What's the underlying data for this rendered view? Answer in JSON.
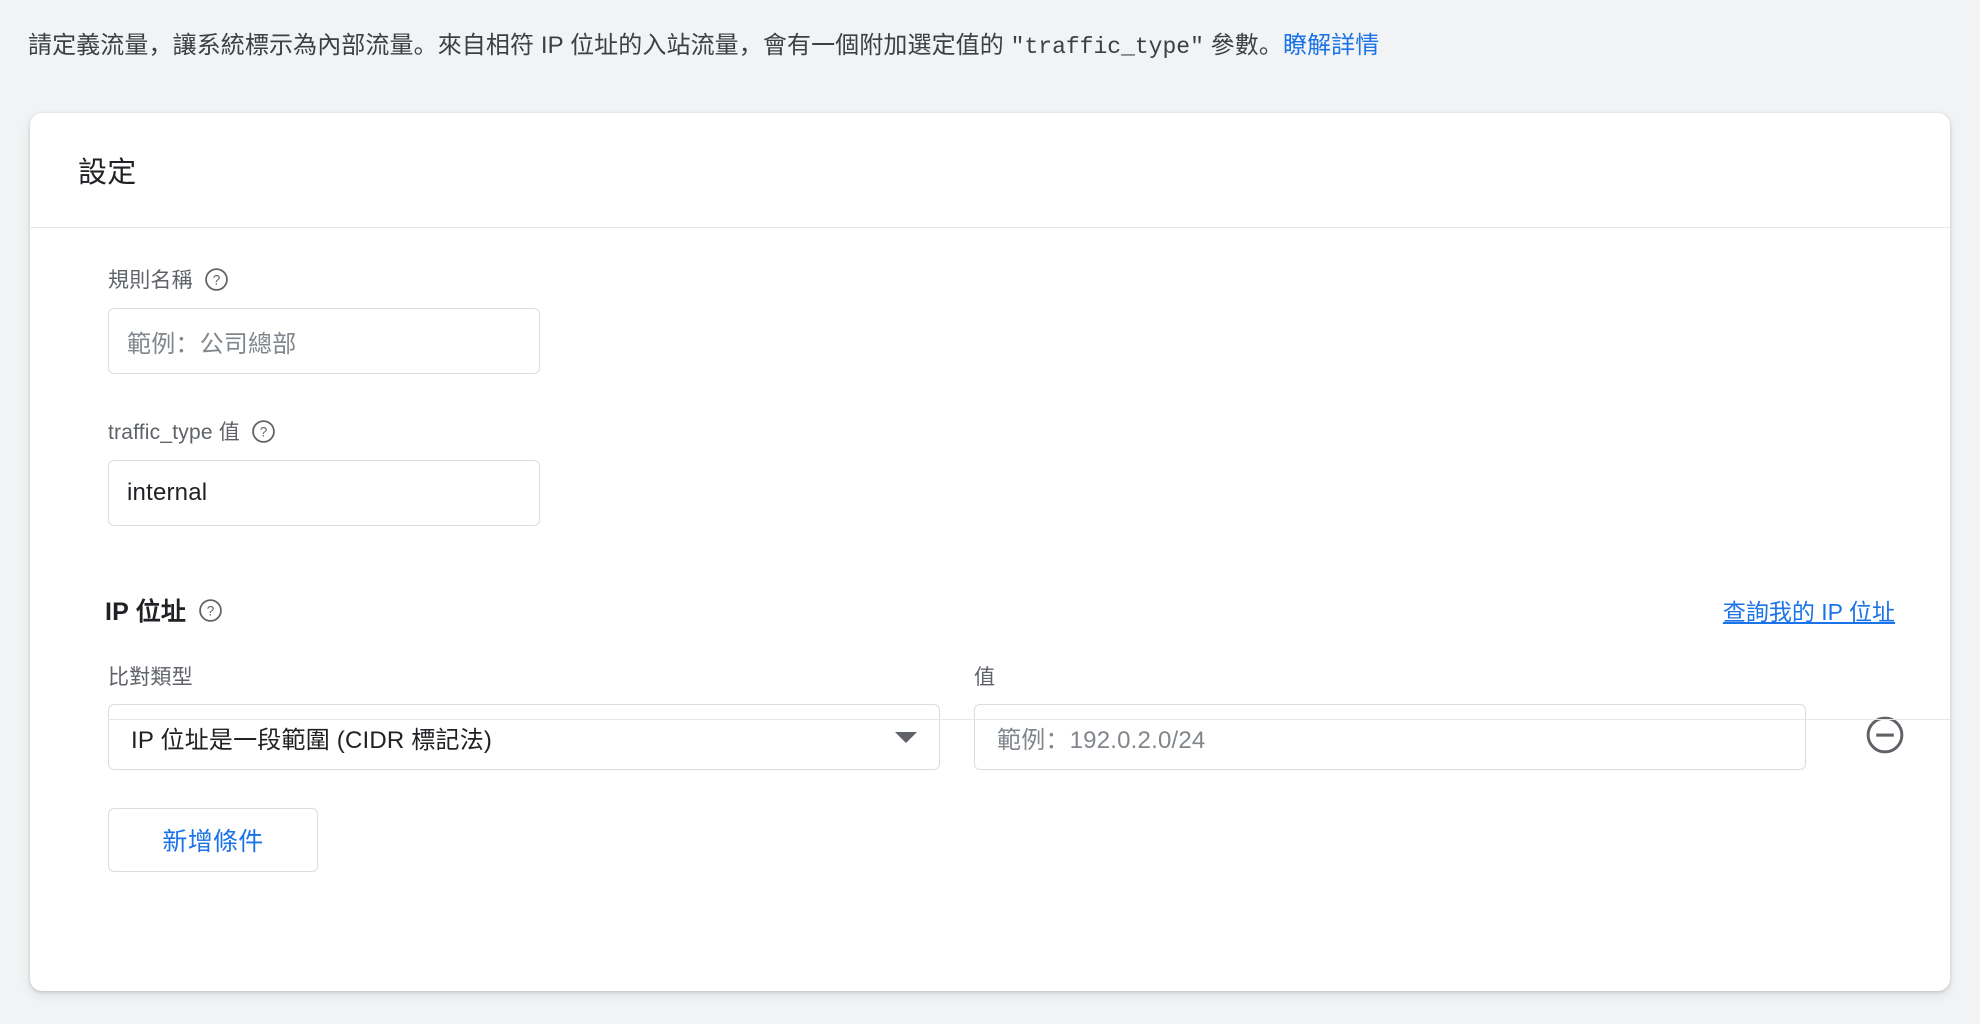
{
  "banner": {
    "text_part1": "請定義流量，讓系統標示為內部流量。來自相符 IP 位址的入站流量，會有一個附加選定值的 ",
    "code": "\"traffic_type\"",
    "text_part2": " 參數。",
    "learn_more": "瞭解詳情"
  },
  "card": {
    "title": "設定",
    "rule_name": {
      "label": "規則名稱",
      "help_icon": "help-circle-icon",
      "placeholder": "範例：公司總部",
      "value": ""
    },
    "traffic_type": {
      "label": "traffic_type 值",
      "help_icon": "help-circle-icon",
      "value": "internal",
      "placeholder": ""
    },
    "ip_section": {
      "title": "IP 位址",
      "help_icon": "help-circle-icon",
      "lookup_link": "查詢我的 IP 位址",
      "match_type_label": "比對類型",
      "match_type_value": "IP 位址是一段範圍 (CIDR 標記法)",
      "dropdown_icon": "chevron-down-icon",
      "value_label": "值",
      "value_placeholder": "範例：192.0.2.0/24",
      "value_current": "",
      "remove_icon": "minus-circle-icon",
      "add_condition_label": "新增條件"
    }
  },
  "colors": {
    "page_background": "#f1f3f4",
    "card_background": "#ffffff",
    "link_blue": "#1a73e8",
    "text_primary": "#202124",
    "text_secondary": "#5f6368",
    "placeholder": "#80868b",
    "border": "#dadce0"
  }
}
